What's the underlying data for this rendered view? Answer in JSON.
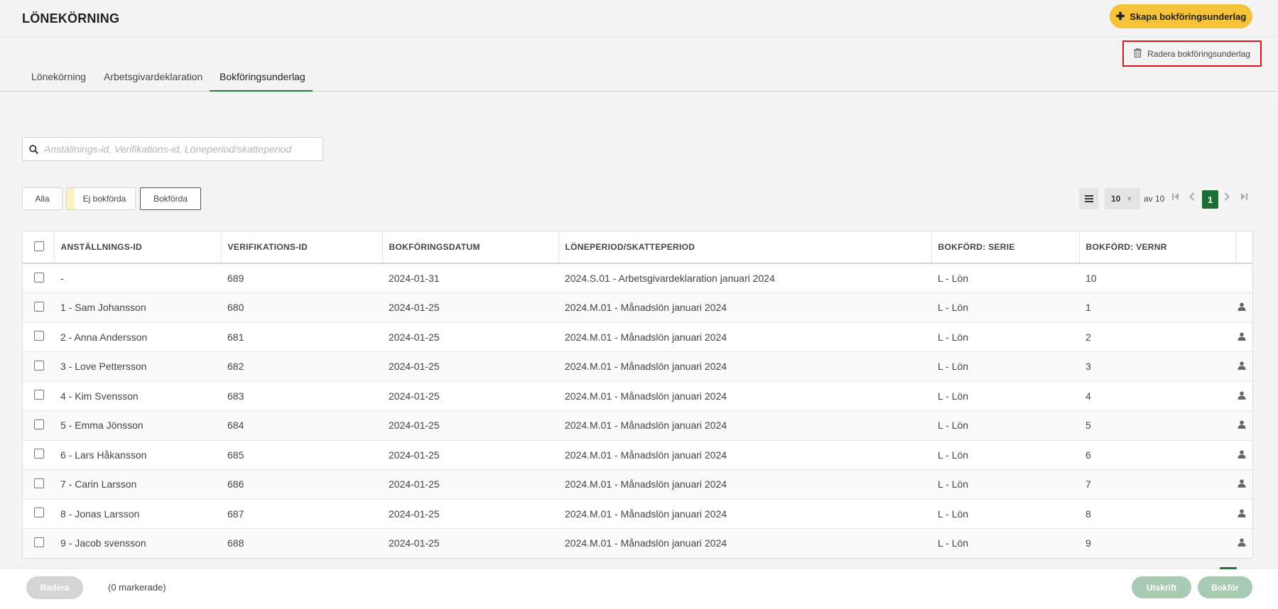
{
  "header": {
    "title": "LÖNEKÖRNING",
    "create_label": "Skapa bokföringsunderlag",
    "delete_label": "Radera bokföringsunderlag"
  },
  "tabs": [
    {
      "label": "Lönekörning"
    },
    {
      "label": "Arbetsgivardeklaration"
    },
    {
      "label": "Bokföringsunderlag"
    }
  ],
  "search": {
    "placeholder": "Anställnings-id, Verifikations-id, Löneperiod/skatteperiod",
    "value": ""
  },
  "filters": {
    "all": "Alla",
    "unbooked": "Ej bokförda",
    "booked": "Bokförda"
  },
  "pagination": {
    "page_size": "10",
    "of_label": "av 10",
    "current_page": "1"
  },
  "table": {
    "columns": [
      "ANSTÄLLNINGS-ID",
      "VERIFIKATIONS-ID",
      "BOKFÖRINGSDATUM",
      "LÖNEPERIOD/SKATTEPERIOD",
      "BOKFÖRD: SERIE",
      "BOKFÖRD: VERNR"
    ],
    "rows": [
      {
        "emp": "-",
        "ver": "689",
        "date": "2024-01-31",
        "period": "2024.S.01 - Arbetsgivardeklaration januari 2024",
        "serie": "L - Lön",
        "vernr": "10",
        "user_icon": false
      },
      {
        "emp": "1 - Sam Johansson",
        "ver": "680",
        "date": "2024-01-25",
        "period": "2024.M.01 - Månadslön januari 2024",
        "serie": "L - Lön",
        "vernr": "1",
        "user_icon": true
      },
      {
        "emp": "2 - Anna Andersson",
        "ver": "681",
        "date": "2024-01-25",
        "period": "2024.M.01 - Månadslön januari 2024",
        "serie": "L - Lön",
        "vernr": "2",
        "user_icon": true
      },
      {
        "emp": "3 - Love Pettersson",
        "ver": "682",
        "date": "2024-01-25",
        "period": "2024.M.01 - Månadslön januari 2024",
        "serie": "L - Lön",
        "vernr": "3",
        "user_icon": true
      },
      {
        "emp": "4 - Kim Svensson",
        "ver": "683",
        "date": "2024-01-25",
        "period": "2024.M.01 - Månadslön januari 2024",
        "serie": "L - Lön",
        "vernr": "4",
        "user_icon": true
      },
      {
        "emp": "5 - Emma Jönsson",
        "ver": "684",
        "date": "2024-01-25",
        "period": "2024.M.01 - Månadslön januari 2024",
        "serie": "L - Lön",
        "vernr": "5",
        "user_icon": true
      },
      {
        "emp": "6 - Lars Håkansson",
        "ver": "685",
        "date": "2024-01-25",
        "period": "2024.M.01 - Månadslön januari 2024",
        "serie": "L - Lön",
        "vernr": "6",
        "user_icon": true
      },
      {
        "emp": "7 - Carin Larsson",
        "ver": "686",
        "date": "2024-01-25",
        "period": "2024.M.01 - Månadslön januari 2024",
        "serie": "L - Lön",
        "vernr": "7",
        "user_icon": true
      },
      {
        "emp": "8 - Jonas Larsson",
        "ver": "687",
        "date": "2024-01-25",
        "period": "2024.M.01 - Månadslön januari 2024",
        "serie": "L - Lön",
        "vernr": "8",
        "user_icon": true
      },
      {
        "emp": "9 - Jacob svensson",
        "ver": "688",
        "date": "2024-01-25",
        "period": "2024.M.01 - Månadslön januari 2024",
        "serie": "L - Lön",
        "vernr": "9",
        "user_icon": true
      }
    ]
  },
  "footer": {
    "delete_label": "Radera",
    "marked_label": "(0 markerade)",
    "print_label": "Utskrift",
    "book_label": "Bokför"
  },
  "colors": {
    "accent_yellow": "#f5c23a",
    "brand_green": "#1d6e35",
    "highlight_red": "#e0131a"
  }
}
